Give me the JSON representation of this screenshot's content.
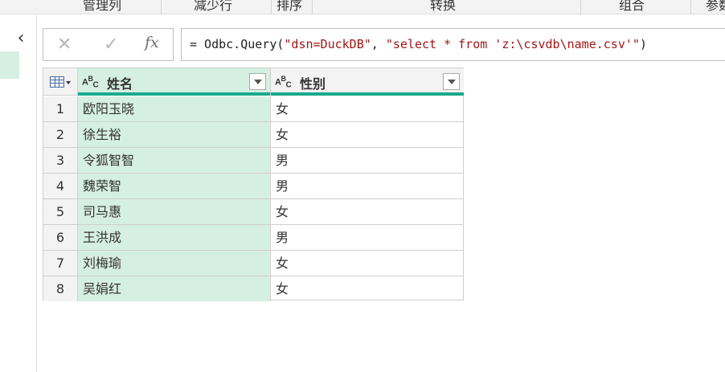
{
  "ribbon": {
    "items": [
      "管理列",
      "减少行",
      "排序",
      "转换",
      "组合",
      "参数"
    ]
  },
  "formula_bar": {
    "formula_prefix": "= Odbc.Query(",
    "arg1": "\"dsn=DuckDB\"",
    "sep": ", ",
    "arg2": "\"select * from 'z:\\csvdb\\name.csv'\"",
    "suffix": ")",
    "fx_label": "fx"
  },
  "table": {
    "columns": [
      {
        "type_icon": "ABC",
        "name": "姓名"
      },
      {
        "type_icon": "ABC",
        "name": "性别"
      }
    ],
    "rows": [
      {
        "n": "1",
        "name": "欧阳玉晓",
        "gender": "女"
      },
      {
        "n": "2",
        "name": "徐生裕",
        "gender": "女"
      },
      {
        "n": "3",
        "name": "令狐智智",
        "gender": "男"
      },
      {
        "n": "4",
        "name": "魏荣智",
        "gender": "男"
      },
      {
        "n": "5",
        "name": "司马惠",
        "gender": "女"
      },
      {
        "n": "6",
        "name": "王洪成",
        "gender": "男"
      },
      {
        "n": "7",
        "name": "刘梅瑜",
        "gender": "女"
      },
      {
        "n": "8",
        "name": "吴娟红",
        "gender": "女"
      }
    ]
  },
  "colors": {
    "selected_column": "#d6efe3",
    "accent_bar": "#1aa98d",
    "string_literal": "#a31515"
  }
}
